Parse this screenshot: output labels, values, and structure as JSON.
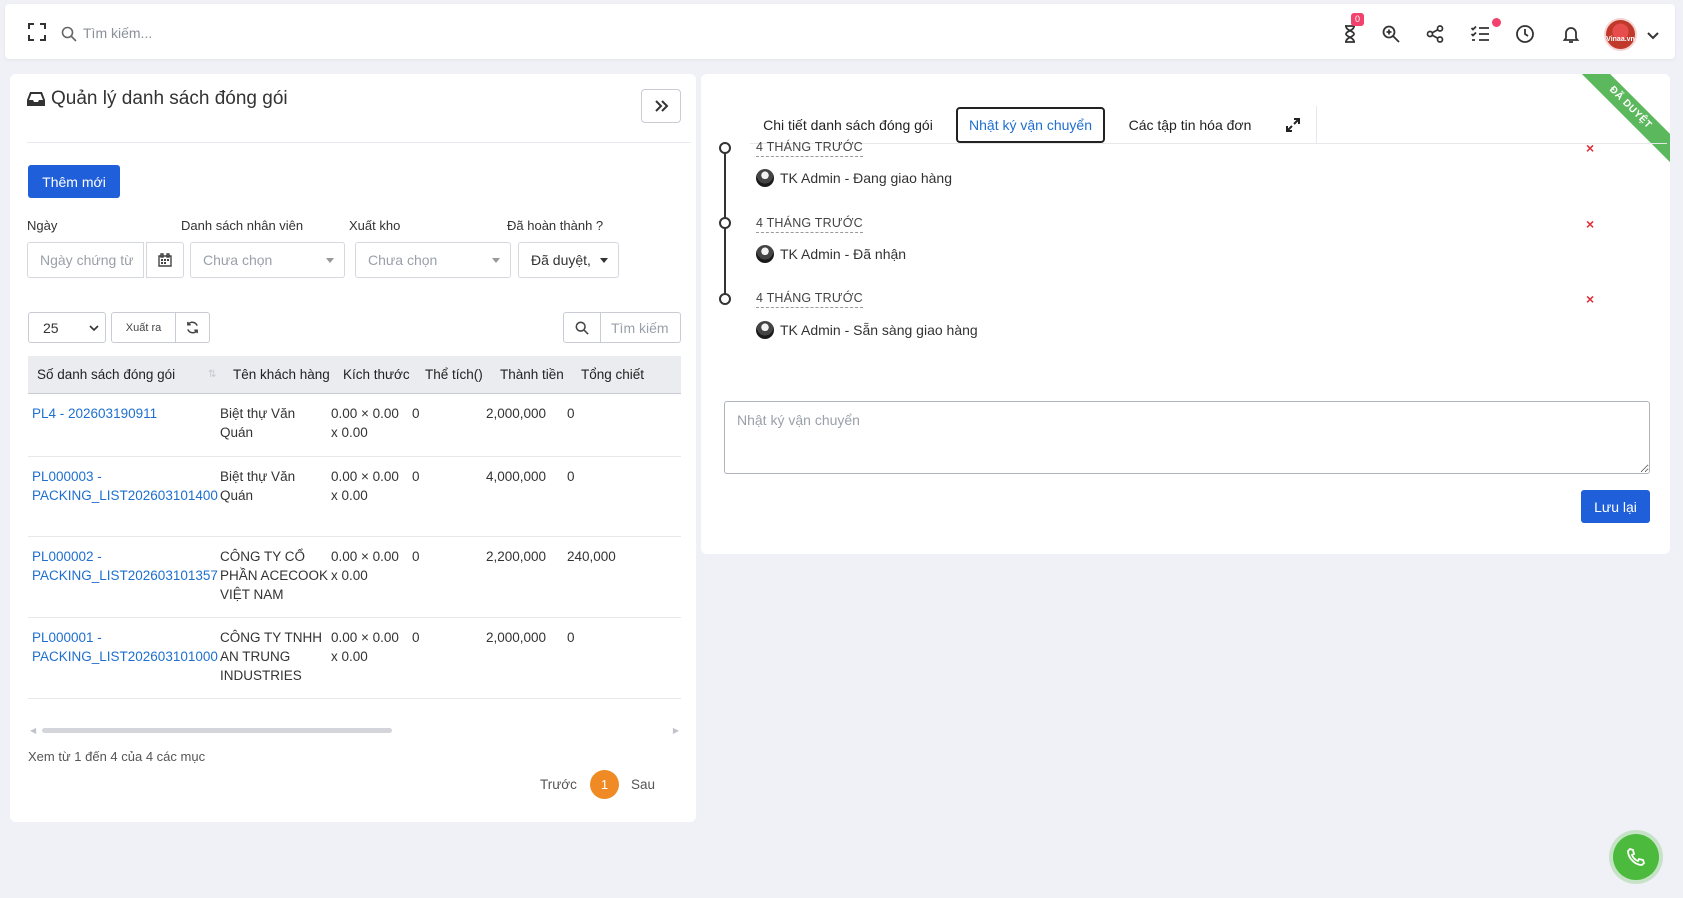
{
  "topbar": {
    "search_placeholder": "Tìm kiếm...",
    "timer_badge": "0",
    "icons": [
      "expand-icon",
      "search-icon",
      "hourglass-icon",
      "search-zoom-icon",
      "share-icon",
      "task-list-icon",
      "clock-icon",
      "bell-icon",
      "user-avatar",
      "chevron-down-icon"
    ],
    "avatar_label": "Vinaa.vn"
  },
  "left_panel": {
    "title": "Quản lý danh sách đóng gói",
    "add_button": "Thêm mới",
    "filters": {
      "date_label": "Ngày",
      "date_placeholder": "Ngày chứng từ",
      "staff_label": "Danh sách nhân viên",
      "staff_value": "Chưa chọn",
      "warehouse_label": "Xuất kho",
      "warehouse_value": "Chưa chọn",
      "done_label": "Đã hoàn thành ?",
      "done_value": "Đã duyệt,"
    },
    "toolbar": {
      "page_size": "25",
      "export_label": "Xuất ra",
      "search_placeholder": "Tìm kiếm"
    },
    "table": {
      "columns": [
        "Số danh sách đóng gói",
        "Tên khách hàng",
        "Kích thước",
        "Thể tích()",
        "Thành tiền",
        "Tổng chiết"
      ],
      "rows": [
        {
          "code1": "PL4 - 202603190911",
          "code2": "",
          "customer": [
            "Biệt thự Văn",
            "Quán",
            ""
          ],
          "size1": "0.00 × 0.00",
          "size2": "x 0.00",
          "volume": "0",
          "amount": "2,000,000",
          "discount": "0"
        },
        {
          "code1": "PL000003 -",
          "code2": "PACKING_LIST202603101400",
          "customer": [
            "Biệt thự Văn",
            "Quán",
            ""
          ],
          "size1": "0.00 × 0.00",
          "size2": "x 0.00",
          "volume": "0",
          "amount": "4,000,000",
          "discount": "0"
        },
        {
          "code1": "PL000002 -",
          "code2": "PACKING_LIST202603101357",
          "customer": [
            "CÔNG TY CỔ",
            "PHẦN ACECOOK",
            "VIỆT NAM"
          ],
          "size1": "0.00 × 0.00",
          "size2": "x 0.00",
          "volume": "0",
          "amount": "2,200,000",
          "discount": "240,000"
        },
        {
          "code1": "PL000001 -",
          "code2": "PACKING_LIST202603101000",
          "customer": [
            "CÔNG TY TNHH",
            "AN TRUNG",
            "INDUSTRIES"
          ],
          "size1": "0.00 × 0.00",
          "size2": "x 0.00",
          "volume": "0",
          "amount": "2,000,000",
          "discount": "0"
        }
      ]
    },
    "info": "Xem từ 1 đến 4 của 4 các mục",
    "pagination": {
      "prev": "Trước",
      "current": "1",
      "next": "Sau"
    }
  },
  "right_panel": {
    "ribbon": "ĐÃ DUYỆT",
    "tabs": [
      "Chi tiết danh sách đóng gói",
      "Nhật ký vận chuyển",
      "Các tập tin hóa đơn"
    ],
    "active_tab": "Nhật ký vận chuyển",
    "timeline": [
      {
        "time": "4 THÁNG TRƯỚC",
        "text": "TK Admin - Đang giao hàng"
      },
      {
        "time": "4 THÁNG TRƯỚC",
        "text": "TK Admin - Đã nhận"
      },
      {
        "time": "4 THÁNG TRƯỚC",
        "text": "TK Admin - Sẵn sàng giao hàng"
      }
    ],
    "note_placeholder": "Nhật ký vận chuyển",
    "save_button": "Lưu lại",
    "delete_mark": "×"
  },
  "colors": {
    "primary": "#1f5fd9",
    "link": "#1e6fd0",
    "approved": "#5cb85c",
    "page_active": "#f08a24",
    "danger": "#e0303a",
    "call": "#4cba3c"
  }
}
